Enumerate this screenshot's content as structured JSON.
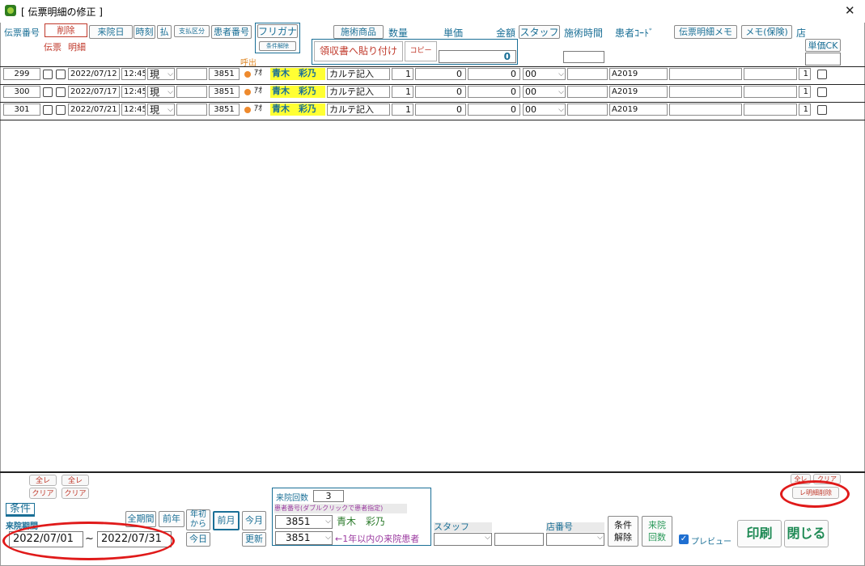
{
  "window": {
    "title": "[ 伝票明細の修正 ]",
    "close_glyph": "✕"
  },
  "header": {
    "denpyo_no": "伝票番号",
    "delete": "削除",
    "denpyo": "伝票",
    "meisai": "明細",
    "raiin_bi": "来院日",
    "jikoku": "時刻",
    "harai": "払",
    "shiharai_kubun": "支払区分",
    "kanja_no": "患者番号",
    "furigana": "フリガナ",
    "joken_kaijo": "条件解除",
    "yobidashi": "呼出",
    "sejutsu_shohin": "施術商品",
    "suryo": "数量",
    "tanka": "単価",
    "kingaku": "金額",
    "staff": "スタッフ",
    "sejutsu_jikan": "施術時間",
    "kanja_code": "患者ｺｰﾄﾞ",
    "denpyo_memo": "伝票明細メモ",
    "memo_hoken": "メモ(保険)",
    "mise": "店",
    "tanka_ck": "単価CK",
    "ryoshusho": "領収書へ貼り付け",
    "copy": "コピー",
    "total_value": "0"
  },
  "rows": [
    {
      "no": "299",
      "date": "2022/07/12",
      "time": "12:45",
      "pay": "現",
      "patient_no": "3851",
      "kana": "ｱｵ",
      "name": "青木　彩乃",
      "item": "カルテ記入",
      "qty": "1",
      "unit": "0",
      "amount": "0",
      "staff": "00",
      "code": "A2019",
      "shop": "1"
    },
    {
      "no": "300",
      "date": "2022/07/17",
      "time": "12:45",
      "pay": "現",
      "patient_no": "3851",
      "kana": "ｱｵ",
      "name": "青木　彩乃",
      "item": "カルテ記入",
      "qty": "1",
      "unit": "0",
      "amount": "0",
      "staff": "00",
      "code": "A2019",
      "shop": "1"
    },
    {
      "no": "301",
      "date": "2022/07/21",
      "time": "12:45",
      "pay": "現",
      "patient_no": "3851",
      "kana": "ｱｵ",
      "name": "青木　彩乃",
      "item": "カルテ記入",
      "qty": "1",
      "unit": "0",
      "amount": "0",
      "staff": "00",
      "code": "A2019",
      "shop": "1"
    }
  ],
  "footer": {
    "zenre": "全レ",
    "clear": "クリア",
    "joken": "条件",
    "raiin_kikan": "来院期間",
    "date_from": "2022/07/01",
    "tilde": "~",
    "date_to": "2022/07/31",
    "zen_kikan": "全期間",
    "zennen": "前年",
    "nensho": "年初\nから",
    "kyo": "今日",
    "zengetsu": "前月",
    "kongetsu": "今月",
    "koshin": "更新",
    "raiin_kaisu_label": "来院回数",
    "raiin_kaisu": "3",
    "kanja_hint": "患者番号(ダブルクリックで患者指定)",
    "patient_sel_1": "3851",
    "patient_name": "青木　彩乃",
    "patient_sel_2": "3851",
    "within_year": "←1年以内の来院患者",
    "staff": "スタッフ",
    "tenban": "店番号",
    "joken_kaijo_1": "条件",
    "joken_kaijo_2": "解除",
    "raiin_1": "来院",
    "raiin_2": "回数",
    "preview": "プレビュー",
    "print": "印刷",
    "close": "閉じる",
    "zenre2": "全レ",
    "clear2": "クリア",
    "meisai_sakujo": "レ明細削除"
  },
  "colors": {
    "accent": "#1a6f96",
    "red": "#c0392b",
    "name_bg": "#ffff33",
    "orange_dot": "#ee8a2e",
    "annotation": "#e01a1a"
  }
}
